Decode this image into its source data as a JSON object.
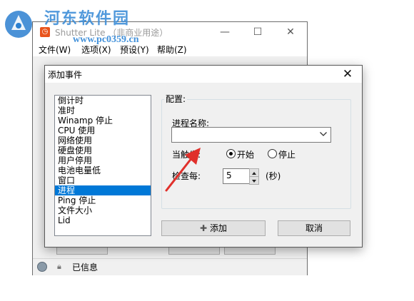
{
  "watermark": {
    "title": "河东软件园",
    "url": "www.pc0359.cn"
  },
  "main_window": {
    "title": "Shutter Lite （非商业用途）",
    "controls": {
      "minimize": "—",
      "maximize": "☐",
      "close": "✕"
    },
    "menu": [
      "文件(W)",
      "选项(X)",
      "预设(Y)",
      "帮助(Z)"
    ],
    "status_text": "已信息"
  },
  "dialog": {
    "title": "添加事件",
    "close_glyph": "✕",
    "events": [
      "倒计时",
      "准时",
      "Winamp 停止",
      "CPU 使用",
      "网络使用",
      "硬盘使用",
      "用户停用",
      "电池电量低",
      "窗口",
      "进程",
      "Ping 停止",
      "文件大小",
      "Lid"
    ],
    "selected_event": "进程",
    "config": {
      "group_label": "配置:",
      "process_name_label": "进程名称:",
      "process_name_value": "",
      "trigger_label": "当触发:",
      "trigger_options": [
        "开始",
        "停止"
      ],
      "trigger_selected": "开始",
      "interval_label": "检查每:",
      "interval_value": "5",
      "interval_unit": "(秒)"
    },
    "buttons": {
      "add": "添加",
      "add_icon": "plus-icon",
      "cancel": "取消"
    }
  },
  "colors": {
    "selection": "#0078d7",
    "annotation_arrow": "#e0302b",
    "watermark": "#3f8fd8",
    "app_icon": "#e9541c"
  }
}
